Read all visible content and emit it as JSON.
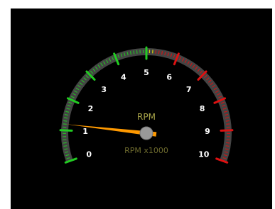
{
  "gauge": {
    "label": "RPM",
    "unit_label": "RPM x1000",
    "min": 0,
    "max": 10,
    "value": 1.2,
    "tick_labels": [
      "0",
      "1",
      "2",
      "3",
      "4",
      "5",
      "6",
      "7",
      "8",
      "9",
      "10"
    ],
    "minor_ticks_per_major": 10,
    "zones": [
      {
        "from": 0,
        "to": 5,
        "color": "#22cc22"
      },
      {
        "from": 5,
        "to": 5.2,
        "color": "#eeee00"
      },
      {
        "from": 5.2,
        "to": 10,
        "color": "#dd1111"
      }
    ],
    "colors": {
      "background": "#000000",
      "arc_track": "#444444",
      "needle": "#ff9900",
      "hub": "#999999",
      "label": "#aaa64a",
      "unit_label": "#6e6b2e",
      "tick_text": "#ffffff"
    }
  }
}
